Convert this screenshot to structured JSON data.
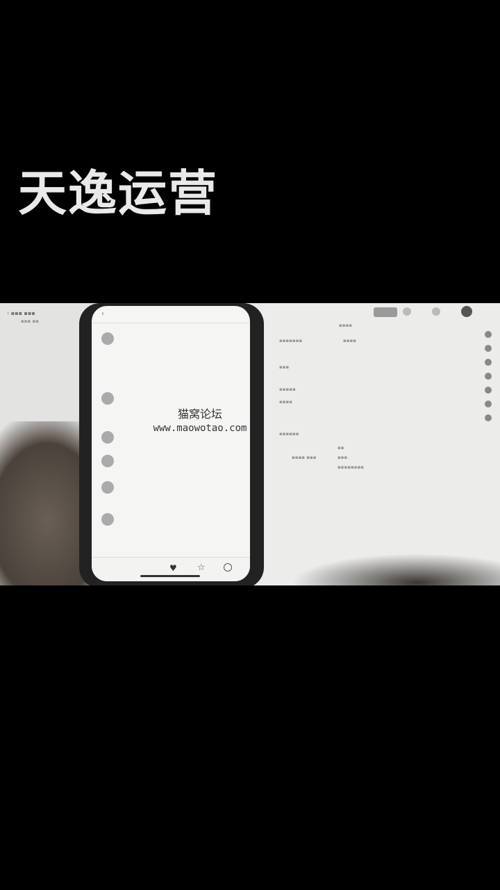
{
  "overlay_title": "天逸运营",
  "watermark": {
    "line1": "猫窝论坛",
    "line2": "www.maowotao.com"
  },
  "phone": {
    "header_title": "",
    "comments": [
      {
        "name": "",
        "text": "",
        "meta": ""
      },
      {
        "name": "",
        "text": "",
        "meta": ""
      },
      {
        "name": "",
        "text": "",
        "meta": ""
      },
      {
        "name": "",
        "text": "",
        "meta": ""
      },
      {
        "name": "",
        "text": "",
        "meta": ""
      },
      {
        "name": "",
        "text": "",
        "meta": ""
      }
    ],
    "bottombar": {
      "input_placeholder": "",
      "likes": "",
      "stars": "",
      "comments": ""
    }
  },
  "icons": [
    "back-icon",
    "heart-icon",
    "star-icon",
    "comment-icon",
    "avatar-icon"
  ],
  "colors": {
    "background": "#000000",
    "title_text": "#e9e9e9",
    "frame_bg": "#eaeae8"
  }
}
